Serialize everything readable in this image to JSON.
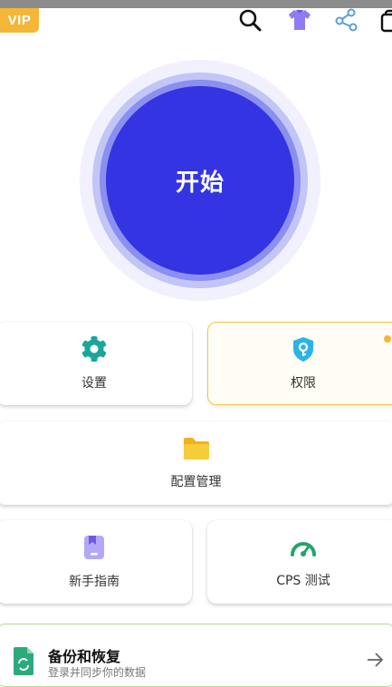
{
  "badge": {
    "vip": "VIP"
  },
  "toolbar": {
    "icons": [
      "search-icon",
      "theme-shirt-icon",
      "share-icon",
      "copy-icon"
    ]
  },
  "start": {
    "label": "开始"
  },
  "grid": {
    "settings": {
      "label": "设置",
      "icon": "gear-icon"
    },
    "permissions": {
      "label": "权限",
      "icon": "shield-key-icon"
    },
    "config": {
      "label": "配置管理",
      "icon": "folder-icon"
    },
    "guide": {
      "label": "新手指南",
      "icon": "bookmark-book-icon"
    },
    "cps": {
      "label": "CPS 测试",
      "icon": "speedometer-icon"
    }
  },
  "backup": {
    "title": "备份和恢复",
    "subtitle": "登录并同步你的数据",
    "icon": "sync-file-icon"
  },
  "colors": {
    "accent": "#3434e2",
    "vip": "#f4b636",
    "teal": "#1aa79a",
    "folder": "#f5c428"
  }
}
